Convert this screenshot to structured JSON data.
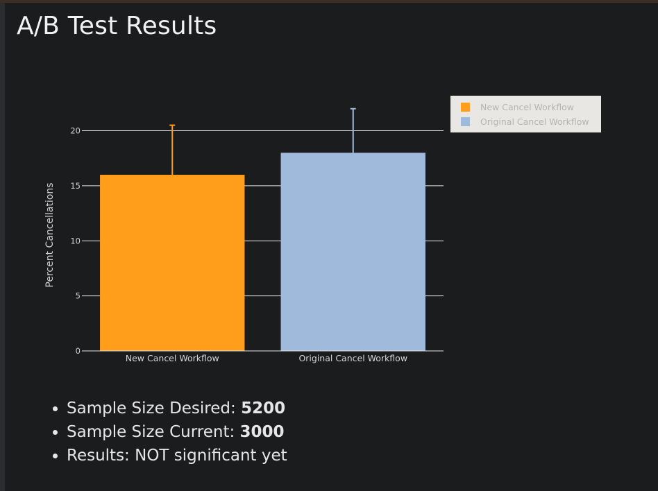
{
  "page": {
    "title": "A/B Test Results"
  },
  "chart_data": {
    "type": "bar",
    "categories": [
      "New Cancel Workflow",
      "Original Cancel Workflow"
    ],
    "values": [
      16,
      18
    ],
    "error_upper": [
      20.5,
      22
    ],
    "colors": [
      "#ff9e1b",
      "#9fbadb"
    ],
    "ylabel": "Percent Cancellations",
    "xlabel": "",
    "ylim": [
      0,
      22.3
    ],
    "yticks": [
      0,
      5,
      10,
      15,
      20
    ],
    "grid": true,
    "legend": {
      "placement": "top-right",
      "entries": [
        "New Cancel Workflow",
        "Original Cancel Workflow"
      ]
    }
  },
  "stats": {
    "desired_label": "Sample Size Desired: ",
    "desired_value": "5200",
    "current_label": "Sample Size Current: ",
    "current_value": "3000",
    "results_text": "Results: NOT significant yet"
  }
}
